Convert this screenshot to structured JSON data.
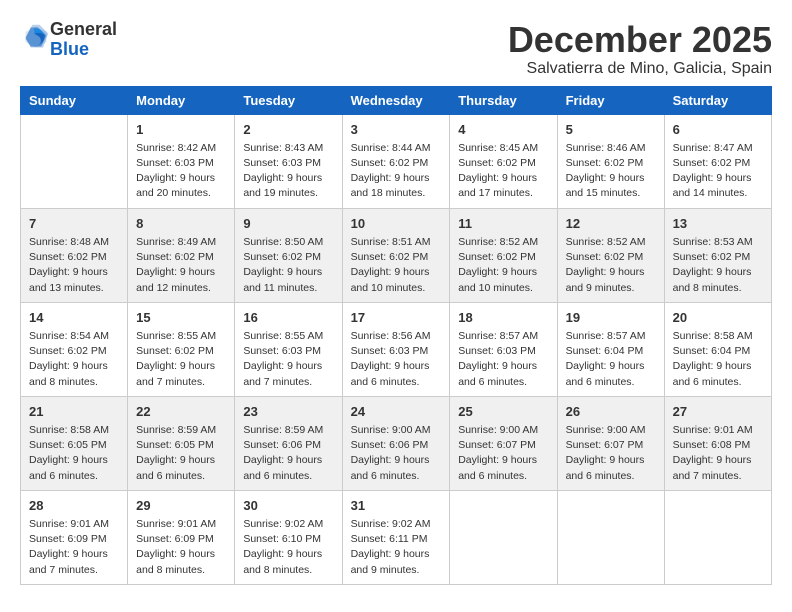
{
  "logo": {
    "general": "General",
    "blue": "Blue"
  },
  "header": {
    "month": "December 2025",
    "location": "Salvatierra de Mino, Galicia, Spain"
  },
  "weekdays": [
    "Sunday",
    "Monday",
    "Tuesday",
    "Wednesday",
    "Thursday",
    "Friday",
    "Saturday"
  ],
  "weeks": [
    [
      {
        "day": "",
        "info": ""
      },
      {
        "day": "1",
        "info": "Sunrise: 8:42 AM\nSunset: 6:03 PM\nDaylight: 9 hours\nand 20 minutes."
      },
      {
        "day": "2",
        "info": "Sunrise: 8:43 AM\nSunset: 6:03 PM\nDaylight: 9 hours\nand 19 minutes."
      },
      {
        "day": "3",
        "info": "Sunrise: 8:44 AM\nSunset: 6:02 PM\nDaylight: 9 hours\nand 18 minutes."
      },
      {
        "day": "4",
        "info": "Sunrise: 8:45 AM\nSunset: 6:02 PM\nDaylight: 9 hours\nand 17 minutes."
      },
      {
        "day": "5",
        "info": "Sunrise: 8:46 AM\nSunset: 6:02 PM\nDaylight: 9 hours\nand 15 minutes."
      },
      {
        "day": "6",
        "info": "Sunrise: 8:47 AM\nSunset: 6:02 PM\nDaylight: 9 hours\nand 14 minutes."
      }
    ],
    [
      {
        "day": "7",
        "info": "Sunrise: 8:48 AM\nSunset: 6:02 PM\nDaylight: 9 hours\nand 13 minutes."
      },
      {
        "day": "8",
        "info": "Sunrise: 8:49 AM\nSunset: 6:02 PM\nDaylight: 9 hours\nand 12 minutes."
      },
      {
        "day": "9",
        "info": "Sunrise: 8:50 AM\nSunset: 6:02 PM\nDaylight: 9 hours\nand 11 minutes."
      },
      {
        "day": "10",
        "info": "Sunrise: 8:51 AM\nSunset: 6:02 PM\nDaylight: 9 hours\nand 10 minutes."
      },
      {
        "day": "11",
        "info": "Sunrise: 8:52 AM\nSunset: 6:02 PM\nDaylight: 9 hours\nand 10 minutes."
      },
      {
        "day": "12",
        "info": "Sunrise: 8:52 AM\nSunset: 6:02 PM\nDaylight: 9 hours\nand 9 minutes."
      },
      {
        "day": "13",
        "info": "Sunrise: 8:53 AM\nSunset: 6:02 PM\nDaylight: 9 hours\nand 8 minutes."
      }
    ],
    [
      {
        "day": "14",
        "info": "Sunrise: 8:54 AM\nSunset: 6:02 PM\nDaylight: 9 hours\nand 8 minutes."
      },
      {
        "day": "15",
        "info": "Sunrise: 8:55 AM\nSunset: 6:02 PM\nDaylight: 9 hours\nand 7 minutes."
      },
      {
        "day": "16",
        "info": "Sunrise: 8:55 AM\nSunset: 6:03 PM\nDaylight: 9 hours\nand 7 minutes."
      },
      {
        "day": "17",
        "info": "Sunrise: 8:56 AM\nSunset: 6:03 PM\nDaylight: 9 hours\nand 6 minutes."
      },
      {
        "day": "18",
        "info": "Sunrise: 8:57 AM\nSunset: 6:03 PM\nDaylight: 9 hours\nand 6 minutes."
      },
      {
        "day": "19",
        "info": "Sunrise: 8:57 AM\nSunset: 6:04 PM\nDaylight: 9 hours\nand 6 minutes."
      },
      {
        "day": "20",
        "info": "Sunrise: 8:58 AM\nSunset: 6:04 PM\nDaylight: 9 hours\nand 6 minutes."
      }
    ],
    [
      {
        "day": "21",
        "info": "Sunrise: 8:58 AM\nSunset: 6:05 PM\nDaylight: 9 hours\nand 6 minutes."
      },
      {
        "day": "22",
        "info": "Sunrise: 8:59 AM\nSunset: 6:05 PM\nDaylight: 9 hours\nand 6 minutes."
      },
      {
        "day": "23",
        "info": "Sunrise: 8:59 AM\nSunset: 6:06 PM\nDaylight: 9 hours\nand 6 minutes."
      },
      {
        "day": "24",
        "info": "Sunrise: 9:00 AM\nSunset: 6:06 PM\nDaylight: 9 hours\nand 6 minutes."
      },
      {
        "day": "25",
        "info": "Sunrise: 9:00 AM\nSunset: 6:07 PM\nDaylight: 9 hours\nand 6 minutes."
      },
      {
        "day": "26",
        "info": "Sunrise: 9:00 AM\nSunset: 6:07 PM\nDaylight: 9 hours\nand 6 minutes."
      },
      {
        "day": "27",
        "info": "Sunrise: 9:01 AM\nSunset: 6:08 PM\nDaylight: 9 hours\nand 7 minutes."
      }
    ],
    [
      {
        "day": "28",
        "info": "Sunrise: 9:01 AM\nSunset: 6:09 PM\nDaylight: 9 hours\nand 7 minutes."
      },
      {
        "day": "29",
        "info": "Sunrise: 9:01 AM\nSunset: 6:09 PM\nDaylight: 9 hours\nand 8 minutes."
      },
      {
        "day": "30",
        "info": "Sunrise: 9:02 AM\nSunset: 6:10 PM\nDaylight: 9 hours\nand 8 minutes."
      },
      {
        "day": "31",
        "info": "Sunrise: 9:02 AM\nSunset: 6:11 PM\nDaylight: 9 hours\nand 9 minutes."
      },
      {
        "day": "",
        "info": ""
      },
      {
        "day": "",
        "info": ""
      },
      {
        "day": "",
        "info": ""
      }
    ]
  ]
}
